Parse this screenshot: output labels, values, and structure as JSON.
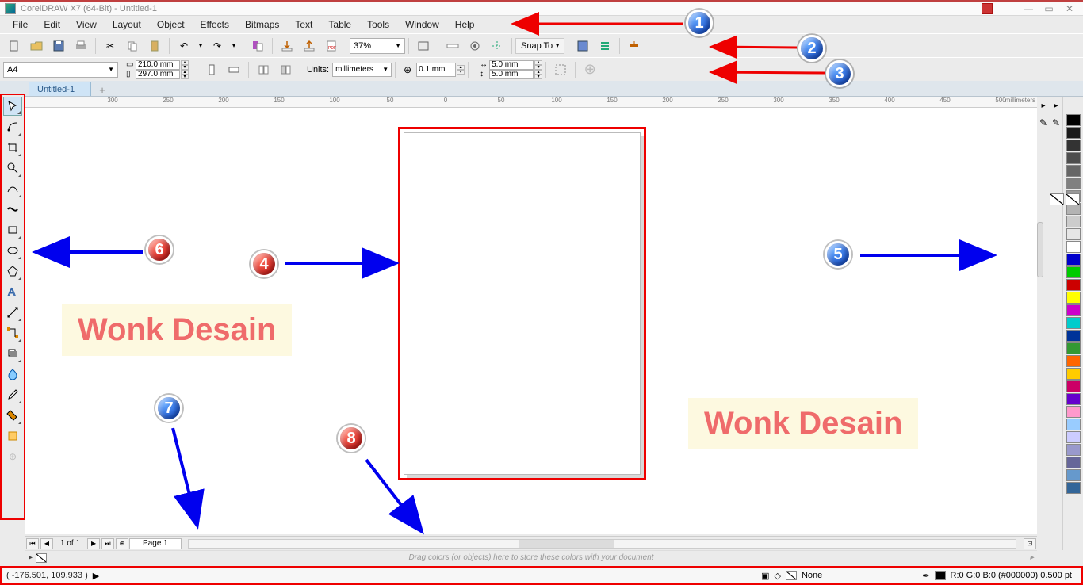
{
  "app": {
    "title": "CorelDRAW X7 (64-Bit) - Untitled-1"
  },
  "menu": {
    "file": "File",
    "edit": "Edit",
    "view": "View",
    "layout": "Layout",
    "object": "Object",
    "effects": "Effects",
    "bitmaps": "Bitmaps",
    "text": "Text",
    "table": "Table",
    "tools": "Tools",
    "window": "Window",
    "help": "Help"
  },
  "toolbar": {
    "zoom": "37%",
    "snap": "Snap To"
  },
  "propbar": {
    "paper": "A4",
    "width": "210.0 mm",
    "height": "297.0 mm",
    "units_label": "Units:",
    "units": "millimeters",
    "nudge": "0.1 mm",
    "dupx": "5.0 mm",
    "dupy": "5.0 mm"
  },
  "doc": {
    "tab": "Untitled-1"
  },
  "ruler": {
    "unit": "millimeters"
  },
  "pagenav": {
    "count": "1 of 1",
    "page": "Page 1"
  },
  "docpal_hint": "Drag colors (or objects) here to store these colors with your document",
  "status": {
    "coords": "( -176.501, 109.933 )",
    "fill_label": "None",
    "outline_label": "R:0 G:0 B:0 (#000000) 0.500 pt"
  },
  "annotations": {
    "wonk1": "Wonk Desain",
    "wonk2": "Wonk Desain",
    "b1": "1",
    "b2": "2",
    "b3": "3",
    "b4": "4",
    "b5": "5",
    "b6": "6",
    "b7": "7",
    "b8": "8"
  },
  "palette_colors": [
    "#000000",
    "#1a1a1a",
    "#333333",
    "#4d4d4d",
    "#666666",
    "#808080",
    "#999999",
    "#b3b3b3",
    "#cccccc",
    "#e6e6e6",
    "#ffffff",
    "#0000cc",
    "#00cc00",
    "#cc0000",
    "#ffff00",
    "#cc00cc",
    "#00cccc",
    "#003399",
    "#339933",
    "#ff6600",
    "#ffcc00",
    "#cc0066",
    "#6600cc",
    "#ff99cc",
    "#99ccff",
    "#ccccff",
    "#9999cc",
    "#666699",
    "#6699cc",
    "#336699"
  ],
  "ruler_ticks": [
    -300,
    -250,
    -200,
    -150,
    -100,
    -50,
    0,
    50,
    100,
    150,
    200,
    250,
    300,
    350,
    400,
    450,
    500
  ]
}
